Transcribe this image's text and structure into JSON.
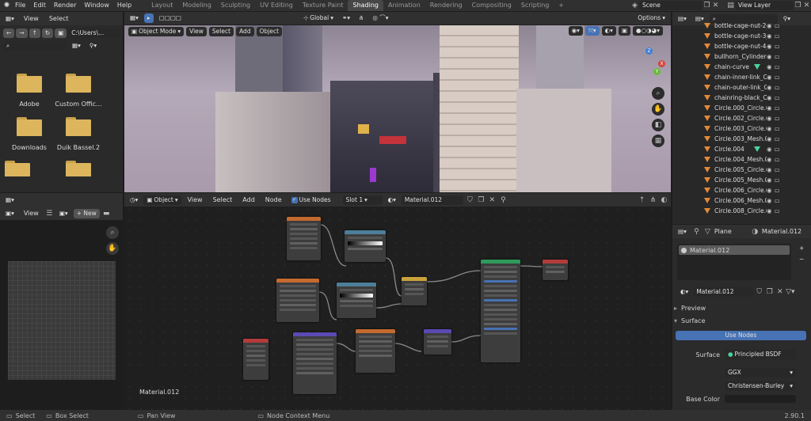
{
  "menus": [
    "File",
    "Edit",
    "Render",
    "Window",
    "Help"
  ],
  "workspaces": [
    "Layout",
    "Modeling",
    "Sculpting",
    "UV Editing",
    "Texture Paint",
    "Shading",
    "Animation",
    "Rendering",
    "Compositing",
    "Scripting"
  ],
  "active_workspace": "Shading",
  "scene": "Scene",
  "view_layer": "View Layer",
  "file_browser": {
    "menus": [
      "View",
      "Select"
    ],
    "path": "C:\\Users\\...",
    "folders": [
      "Adobe",
      "Custom Offic...",
      "Downloads",
      "Duik Bassel.2"
    ]
  },
  "viewport": {
    "mode": "Object Mode",
    "menus": [
      "View",
      "Select",
      "Add",
      "Object"
    ],
    "transform": "Global",
    "options": "Options"
  },
  "image_editor": {
    "view": "View",
    "new": "+ New"
  },
  "node_editor": {
    "mode": "Object",
    "menus": [
      "View",
      "Select",
      "Add",
      "Node"
    ],
    "use_nodes": "Use Nodes",
    "slot": "Slot 1",
    "material": "Material.012",
    "footer_label": "Material.012"
  },
  "outliner": {
    "items": [
      {
        "name": "bottle-cage-nut-2_",
        "icon": "orange"
      },
      {
        "name": "bottle-cage-nut-3_",
        "icon": "orange"
      },
      {
        "name": "bottle-cage-nut-4_",
        "icon": "orange"
      },
      {
        "name": "bullhorn_Cylinder",
        "icon": "orange"
      },
      {
        "name": "chain-curve",
        "icon": "green"
      },
      {
        "name": "chain-inner-link_Ci",
        "icon": "orange"
      },
      {
        "name": "chain-outer-link_Ci",
        "icon": "orange"
      },
      {
        "name": "chainring-black_Ci",
        "icon": "orange"
      },
      {
        "name": "Circle.000_Circle.0",
        "icon": "orange"
      },
      {
        "name": "Circle.002_Circle.0",
        "icon": "orange"
      },
      {
        "name": "Circle.003_Circle.0",
        "icon": "orange"
      },
      {
        "name": "Circle.003_Mesh.0",
        "icon": "orange"
      },
      {
        "name": "Circle.004",
        "icon": "green"
      },
      {
        "name": "Circle.004_Mesh.0",
        "icon": "orange"
      },
      {
        "name": "Circle.005_Circle.0",
        "icon": "orange"
      },
      {
        "name": "Circle.005_Mesh.0",
        "icon": "orange"
      },
      {
        "name": "Circle.006_Circle.0",
        "icon": "orange"
      },
      {
        "name": "Circle.006_Mesh.0",
        "icon": "orange"
      },
      {
        "name": "Circle.008_Circle.0",
        "icon": "orange"
      }
    ]
  },
  "properties": {
    "object": "Plane",
    "material_header": "Material.012",
    "slot_item": "Material.012",
    "material_field": "Material.012",
    "preview": "Preview",
    "surface_section": "Surface",
    "use_nodes": "Use Nodes",
    "surface_label": "Surface",
    "surface_value": "Principled BSDF",
    "distribution": "GGX",
    "subsurface": "Christensen-Burley",
    "base_color_label": "Base Color"
  },
  "status": {
    "select": "Select",
    "box_select": "Box Select",
    "pan_view": "Pan View",
    "node_context": "Node Context Menu",
    "version": "2.90.1"
  },
  "colors": {
    "accent": "#4772b3",
    "active_tab": "#474747",
    "folder": "#dcb55c",
    "node_bsdf": "#2f9a5b",
    "node_output": "#b33b3b",
    "node_texture": "#c46a2e",
    "node_vector": "#5a4ab3"
  }
}
